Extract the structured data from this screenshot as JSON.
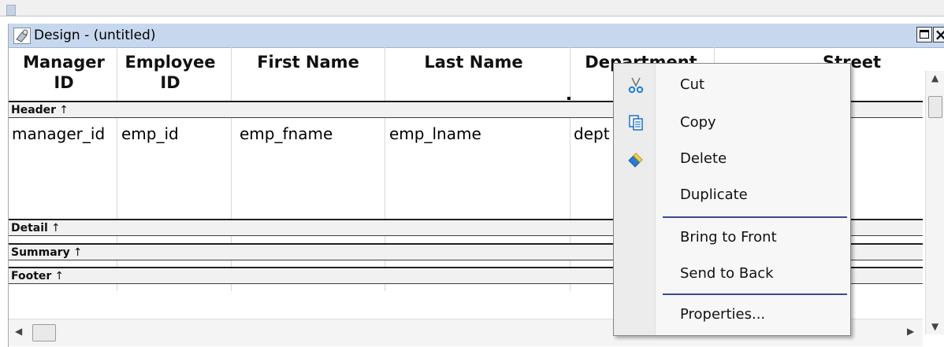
{
  "window": {
    "title": "Design - (untitled)",
    "close_glyph": "×"
  },
  "columns": [
    "Manager\nID",
    "Employee\nID",
    "First Name",
    "Last Name",
    "Department",
    "Street"
  ],
  "cells": [
    "manager_id",
    "emp_id",
    "emp_fname",
    "emp_lname",
    "dept"
  ],
  "bands": {
    "header": "Header",
    "detail": "Detail",
    "summary": "Summary",
    "footer": "Footer",
    "arrow": "↑"
  },
  "context_menu": {
    "items": [
      {
        "label": "Cut",
        "icon": "scissors-icon"
      },
      {
        "label": "Copy",
        "icon": "copy-icon"
      },
      {
        "label": "Delete",
        "icon": "eraser-icon"
      },
      {
        "label": "Duplicate"
      },
      {
        "label": "Bring to Front"
      },
      {
        "label": "Send to Back"
      },
      {
        "label": "Properties..."
      }
    ]
  },
  "colors": {
    "titlebar": "#c7d8ee",
    "separator": "#3a4a8c",
    "band_bg": "#f1f1f1"
  }
}
